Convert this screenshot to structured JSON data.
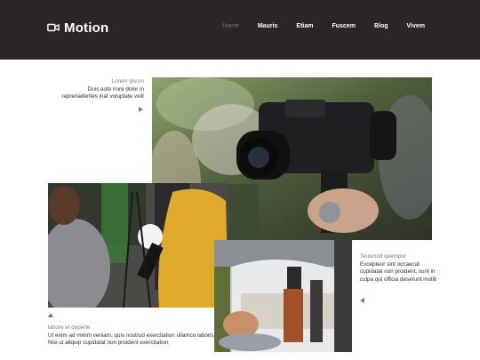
{
  "brand": {
    "name": "Motion",
    "icon": "video-camera-icon"
  },
  "nav": {
    "items": [
      {
        "label": "Home",
        "active": true
      },
      {
        "label": "Mauris",
        "active": false
      },
      {
        "label": "Etiam",
        "active": false
      },
      {
        "label": "Fuscem",
        "active": false
      },
      {
        "label": "Blog",
        "active": false
      },
      {
        "label": "Vivem",
        "active": false
      }
    ]
  },
  "features": [
    {
      "title": "Lorem ipsum",
      "body": "Duis aute irure dolor in reprenaderites inat voluptate velit",
      "arrow": "arrow-right-icon",
      "photo": "videographer-photo"
    },
    {
      "title": "Teusmod quempor",
      "body": "Excepteur sint occaecat cupidatat non proident, sunt in culpa qui officia deserunt mollit",
      "arrow": "arrow-left-icon",
      "photo": "tv-studio-photo"
    },
    {
      "title": "labore et doperle",
      "body": "Ut enim ad minim veniam, quis nostrud exercitation ullamco laboris. Nisi ut aliquip cupidatat non proident exercitation",
      "arrow": "arrow-up-icon",
      "photo": "press-microphone-photo"
    }
  ],
  "colors": {
    "header_bg": "#2b2626",
    "nav_text": "#ffffff",
    "nav_active": "#7b7676",
    "caption_title": "#7a7a7a",
    "caption_body": "#2c2c2c",
    "page_bg": "#ffffff"
  }
}
